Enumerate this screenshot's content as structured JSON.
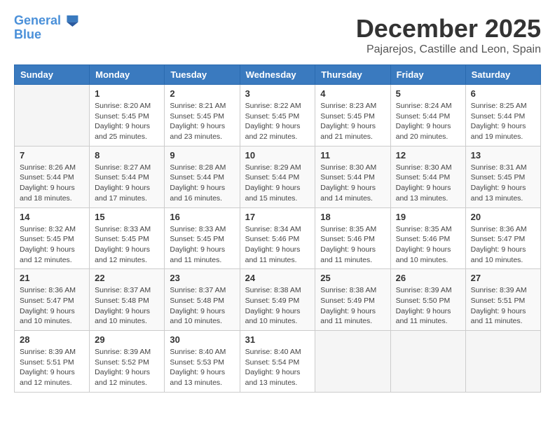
{
  "app": {
    "name_line1": "General",
    "name_line2": "Blue"
  },
  "header": {
    "month": "December 2025",
    "location": "Pajarejos, Castille and Leon, Spain"
  },
  "weekdays": [
    "Sunday",
    "Monday",
    "Tuesday",
    "Wednesday",
    "Thursday",
    "Friday",
    "Saturday"
  ],
  "weeks": [
    [
      {
        "day": "",
        "info": ""
      },
      {
        "day": "1",
        "info": "Sunrise: 8:20 AM\nSunset: 5:45 PM\nDaylight: 9 hours\nand 25 minutes."
      },
      {
        "day": "2",
        "info": "Sunrise: 8:21 AM\nSunset: 5:45 PM\nDaylight: 9 hours\nand 23 minutes."
      },
      {
        "day": "3",
        "info": "Sunrise: 8:22 AM\nSunset: 5:45 PM\nDaylight: 9 hours\nand 22 minutes."
      },
      {
        "day": "4",
        "info": "Sunrise: 8:23 AM\nSunset: 5:45 PM\nDaylight: 9 hours\nand 21 minutes."
      },
      {
        "day": "5",
        "info": "Sunrise: 8:24 AM\nSunset: 5:44 PM\nDaylight: 9 hours\nand 20 minutes."
      },
      {
        "day": "6",
        "info": "Sunrise: 8:25 AM\nSunset: 5:44 PM\nDaylight: 9 hours\nand 19 minutes."
      }
    ],
    [
      {
        "day": "7",
        "info": "Sunrise: 8:26 AM\nSunset: 5:44 PM\nDaylight: 9 hours\nand 18 minutes."
      },
      {
        "day": "8",
        "info": "Sunrise: 8:27 AM\nSunset: 5:44 PM\nDaylight: 9 hours\nand 17 minutes."
      },
      {
        "day": "9",
        "info": "Sunrise: 8:28 AM\nSunset: 5:44 PM\nDaylight: 9 hours\nand 16 minutes."
      },
      {
        "day": "10",
        "info": "Sunrise: 8:29 AM\nSunset: 5:44 PM\nDaylight: 9 hours\nand 15 minutes."
      },
      {
        "day": "11",
        "info": "Sunrise: 8:30 AM\nSunset: 5:44 PM\nDaylight: 9 hours\nand 14 minutes."
      },
      {
        "day": "12",
        "info": "Sunrise: 8:30 AM\nSunset: 5:44 PM\nDaylight: 9 hours\nand 13 minutes."
      },
      {
        "day": "13",
        "info": "Sunrise: 8:31 AM\nSunset: 5:45 PM\nDaylight: 9 hours\nand 13 minutes."
      }
    ],
    [
      {
        "day": "14",
        "info": "Sunrise: 8:32 AM\nSunset: 5:45 PM\nDaylight: 9 hours\nand 12 minutes."
      },
      {
        "day": "15",
        "info": "Sunrise: 8:33 AM\nSunset: 5:45 PM\nDaylight: 9 hours\nand 12 minutes."
      },
      {
        "day": "16",
        "info": "Sunrise: 8:33 AM\nSunset: 5:45 PM\nDaylight: 9 hours\nand 11 minutes."
      },
      {
        "day": "17",
        "info": "Sunrise: 8:34 AM\nSunset: 5:46 PM\nDaylight: 9 hours\nand 11 minutes."
      },
      {
        "day": "18",
        "info": "Sunrise: 8:35 AM\nSunset: 5:46 PM\nDaylight: 9 hours\nand 11 minutes."
      },
      {
        "day": "19",
        "info": "Sunrise: 8:35 AM\nSunset: 5:46 PM\nDaylight: 9 hours\nand 10 minutes."
      },
      {
        "day": "20",
        "info": "Sunrise: 8:36 AM\nSunset: 5:47 PM\nDaylight: 9 hours\nand 10 minutes."
      }
    ],
    [
      {
        "day": "21",
        "info": "Sunrise: 8:36 AM\nSunset: 5:47 PM\nDaylight: 9 hours\nand 10 minutes."
      },
      {
        "day": "22",
        "info": "Sunrise: 8:37 AM\nSunset: 5:48 PM\nDaylight: 9 hours\nand 10 minutes."
      },
      {
        "day": "23",
        "info": "Sunrise: 8:37 AM\nSunset: 5:48 PM\nDaylight: 9 hours\nand 10 minutes."
      },
      {
        "day": "24",
        "info": "Sunrise: 8:38 AM\nSunset: 5:49 PM\nDaylight: 9 hours\nand 10 minutes."
      },
      {
        "day": "25",
        "info": "Sunrise: 8:38 AM\nSunset: 5:49 PM\nDaylight: 9 hours\nand 11 minutes."
      },
      {
        "day": "26",
        "info": "Sunrise: 8:39 AM\nSunset: 5:50 PM\nDaylight: 9 hours\nand 11 minutes."
      },
      {
        "day": "27",
        "info": "Sunrise: 8:39 AM\nSunset: 5:51 PM\nDaylight: 9 hours\nand 11 minutes."
      }
    ],
    [
      {
        "day": "28",
        "info": "Sunrise: 8:39 AM\nSunset: 5:51 PM\nDaylight: 9 hours\nand 12 minutes."
      },
      {
        "day": "29",
        "info": "Sunrise: 8:39 AM\nSunset: 5:52 PM\nDaylight: 9 hours\nand 12 minutes."
      },
      {
        "day": "30",
        "info": "Sunrise: 8:40 AM\nSunset: 5:53 PM\nDaylight: 9 hours\nand 13 minutes."
      },
      {
        "day": "31",
        "info": "Sunrise: 8:40 AM\nSunset: 5:54 PM\nDaylight: 9 hours\nand 13 minutes."
      },
      {
        "day": "",
        "info": ""
      },
      {
        "day": "",
        "info": ""
      },
      {
        "day": "",
        "info": ""
      }
    ]
  ]
}
